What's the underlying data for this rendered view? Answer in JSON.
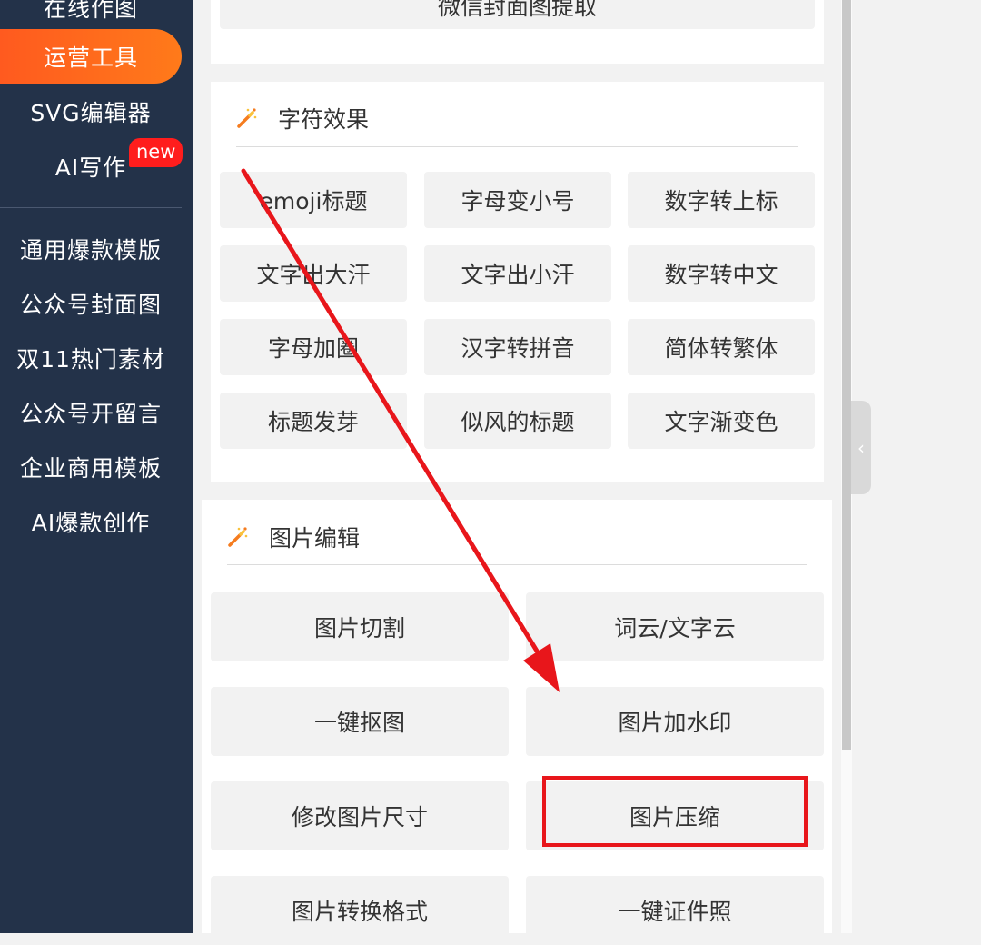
{
  "sidebar": {
    "partial_item": "在线作图",
    "active_item": "运营工具",
    "items_top": [
      "SVG编辑器",
      "AI写作"
    ],
    "new_badge": "new",
    "items_bottom": [
      "通用爆款模版",
      "公众号封面图",
      "双11热门素材",
      "公众号开留言",
      "企业商用模板",
      "AI爆款创作"
    ]
  },
  "top_panel": {
    "partial_button": "微信封面图提取"
  },
  "char_section": {
    "title": "字符效果",
    "icon": "magic-wand-icon",
    "buttons": [
      "emoji标题",
      "字母变小号",
      "数字转上标",
      "文字出大汗",
      "文字出小汗",
      "数字转中文",
      "字母加圈",
      "汉字转拼音",
      "简体转繁体",
      "标题发芽",
      "似风的标题",
      "文字渐变色"
    ]
  },
  "img_section": {
    "title": "图片编辑",
    "icon": "magic-wand-icon",
    "buttons": [
      "图片切割",
      "词云/文字云",
      "一键抠图",
      "图片加水印",
      "修改图片尺寸",
      "图片压缩",
      "图片转换格式",
      "一键证件照"
    ]
  },
  "collapse_handle": "‹",
  "colors": {
    "sidebar_bg": "#233249",
    "active_gradient_start": "#ff5a1f",
    "active_gradient_end": "#ff7a1a",
    "badge_red": "#ff1d1d",
    "annotation_red": "#e8161b"
  }
}
